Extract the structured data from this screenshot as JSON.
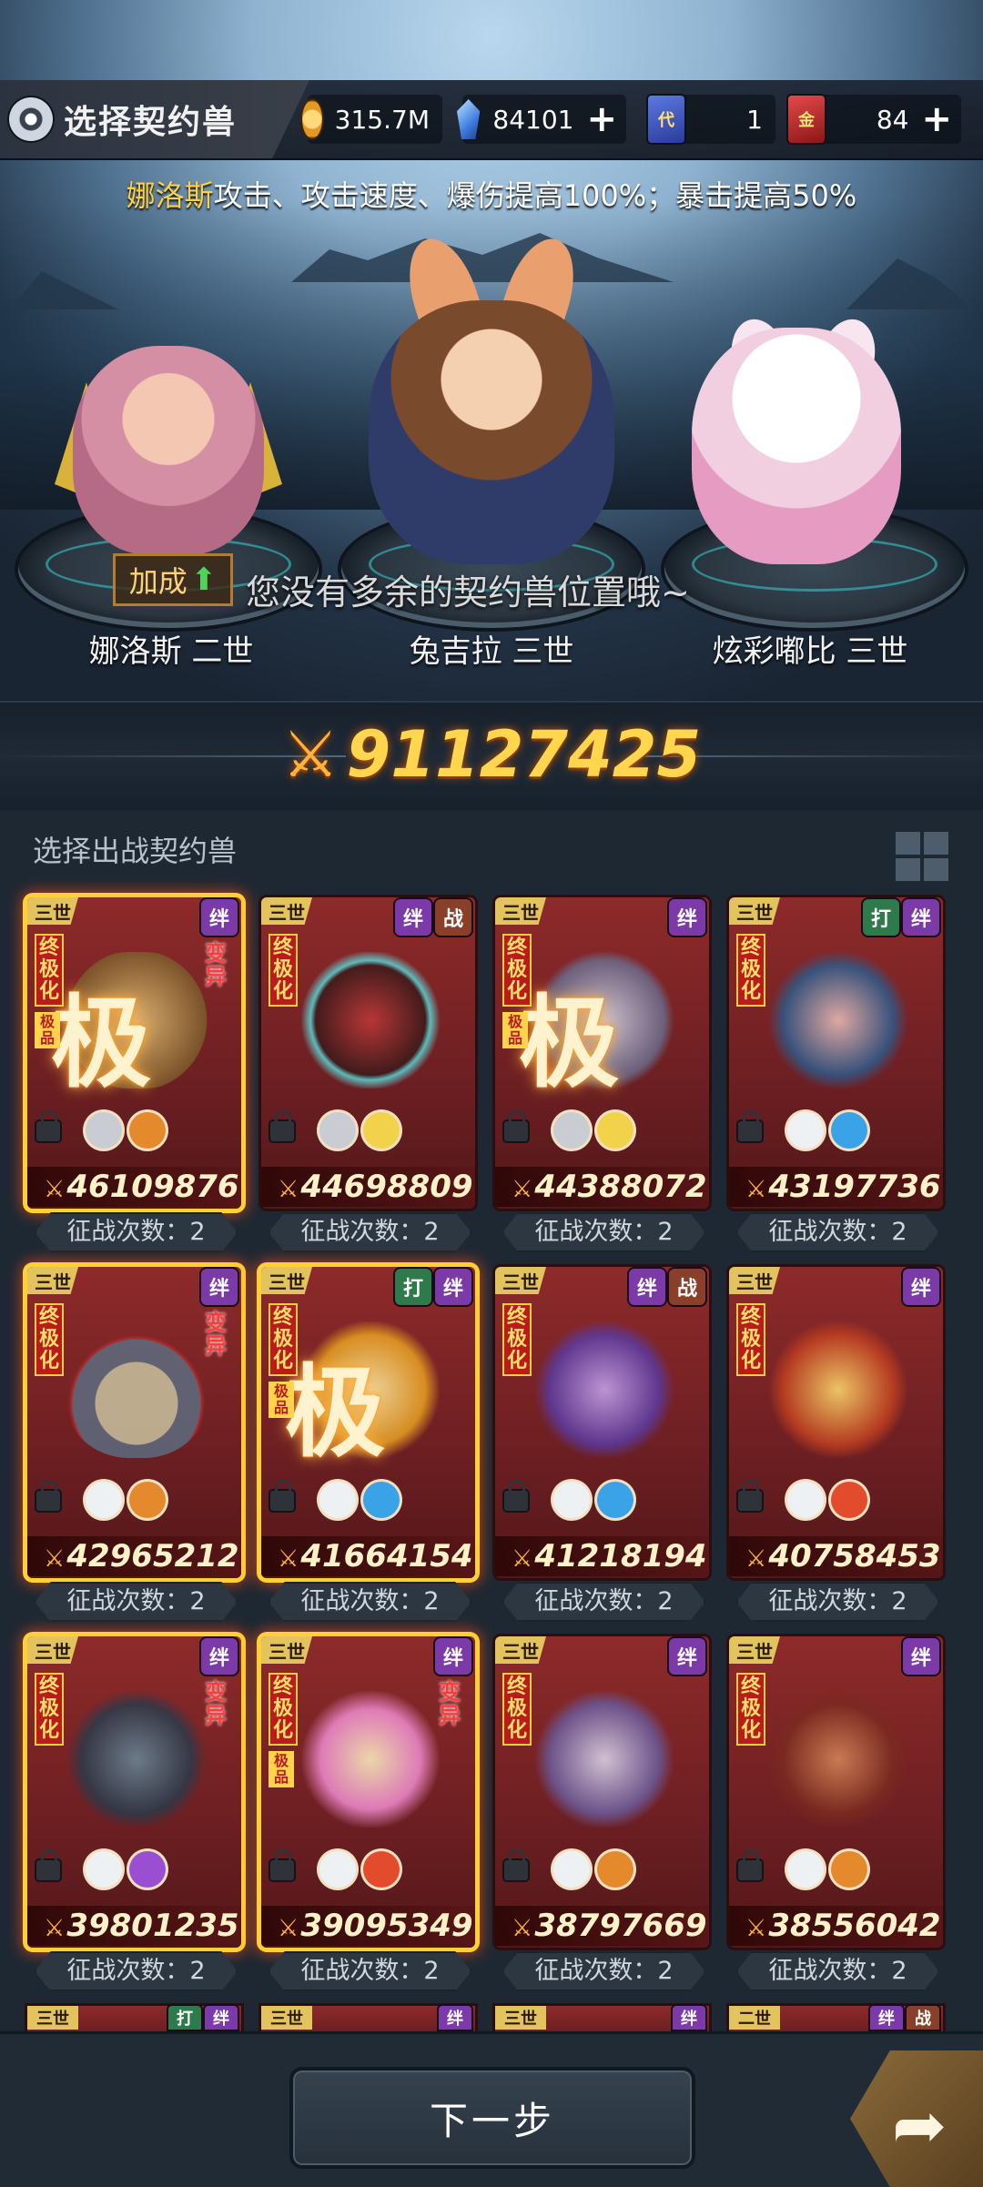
{
  "header": {
    "title": "选择契约兽",
    "resources": [
      {
        "icon": "coin-icon",
        "value": "315.7M"
      },
      {
        "icon": "crystal-icon",
        "value": "84101"
      },
      {
        "icon": "dai-ticket-icon",
        "icon_text": "代",
        "value": "1"
      },
      {
        "icon": "jin-ticket-icon",
        "icon_text": "金",
        "value": "84"
      }
    ]
  },
  "buff": {
    "name": "娜洛斯",
    "text": "攻击、攻击速度、爆伤提高100%；暴击提高50%"
  },
  "lineup": [
    "娜洛斯 二世",
    "兔吉拉 三世",
    "炫彩嘟比 三世"
  ],
  "bonus_label": "加成",
  "toast": "您没有多余的契约兽位置哦~",
  "total_power": "91127425",
  "list": {
    "title": "选择出战契约兽"
  },
  "card_labels": {
    "tier3": "三世",
    "tier2": "二世",
    "ban": "绊",
    "zhan": "战",
    "da": "打",
    "v1": "终极化",
    "v2": "极品",
    "mutation": "变异",
    "ji": "极"
  },
  "cards": [
    {
      "power": "46109876",
      "expedition": "征战次数：2"
    },
    {
      "power": "44698809",
      "expedition": "征战次数：2"
    },
    {
      "power": "44388072",
      "expedition": "征战次数：2"
    },
    {
      "power": "43197736",
      "expedition": "征战次数：2"
    },
    {
      "power": "42965212",
      "expedition": "征战次数：2"
    },
    {
      "power": "41664154",
      "expedition": "征战次数：2"
    },
    {
      "power": "41218194",
      "expedition": "征战次数：2"
    },
    {
      "power": "40758453",
      "expedition": "征战次数：2"
    },
    {
      "power": "39801235",
      "expedition": "征战次数：2"
    },
    {
      "power": "39095349",
      "expedition": "征战次数：2"
    },
    {
      "power": "38797669",
      "expedition": "征战次数：2"
    },
    {
      "power": "38556042",
      "expedition": "征战次数：2"
    }
  ],
  "next_button": "下一步",
  "colors": {
    "accent_gold": "#ffd64d",
    "card_red": "#8e2a2a",
    "glow_border": "#ffcf33"
  }
}
